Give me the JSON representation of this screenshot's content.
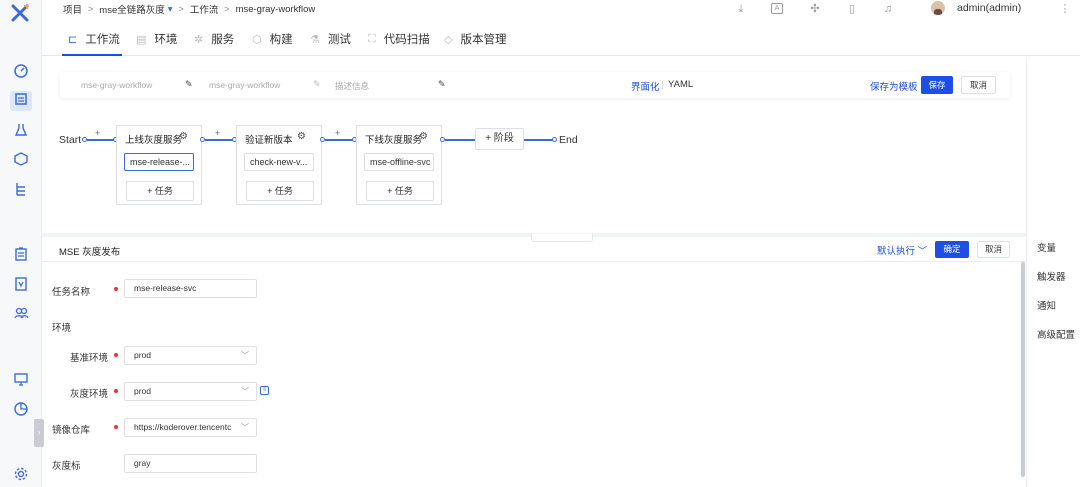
{
  "breadcrumb": {
    "items": [
      "项目",
      "mse全链路灰度",
      "工作流",
      "mse-gray-workflow"
    ],
    "project_dropdown": "▾",
    "sep": ">"
  },
  "header": {
    "user": "admin(admin)",
    "icons": [
      "download-icon",
      "translate-icon",
      "network-icon",
      "docs-icon",
      "bell-icon",
      "more-icon"
    ]
  },
  "tabs": [
    {
      "label": "工作流",
      "icon": "workflow-icon"
    },
    {
      "label": "环境",
      "icon": "environment-icon"
    },
    {
      "label": "服务",
      "icon": "service-icon"
    },
    {
      "label": "构建",
      "icon": "build-icon"
    },
    {
      "label": "测试",
      "icon": "test-icon"
    },
    {
      "label": "代码扫描",
      "icon": "scan-icon"
    },
    {
      "label": "版本管理",
      "icon": "version-icon"
    }
  ],
  "toolbar": {
    "name_placeholder": "mse-gray-workflow",
    "display_placeholder": "mse-gray-workflow",
    "desc_placeholder": "描述信息",
    "mode_ui": "界面化",
    "mode_sep": "|",
    "mode_yaml": "YAML",
    "save_template": "保存为模板",
    "save": "保存",
    "cancel": "取消"
  },
  "pipeline": {
    "start": "Start",
    "end": "End",
    "plus": "+",
    "add_stage": "+ 阶段",
    "add_task": "+ 任务",
    "stages": [
      {
        "name": "上线灰度服务",
        "job": "mse-release-..."
      },
      {
        "name": "验证新版本",
        "job": "check-new-v..."
      },
      {
        "name": "下线灰度服务",
        "job": "mse-offline-svc"
      }
    ]
  },
  "job_panel": {
    "title": "MSE 灰度发布",
    "exec_mode": "默认执行",
    "confirm": "确定",
    "cancel": "取消",
    "fields": {
      "task_name_label": "任务名称",
      "task_name": "mse-release-svc",
      "env_label": "环境",
      "base_env_label": "基准环境",
      "base_env": "prod",
      "gray_env_label": "灰度环境",
      "gray_env": "prod",
      "image_repo_label": "镜像仓库",
      "image_repo": "https://koderover.tencentc",
      "gray_tag_label": "灰度标",
      "gray_tag": "gray"
    }
  },
  "right_panel": [
    "变量",
    "触发器",
    "通知",
    "高级配置"
  ],
  "colors": {
    "primary": "#1e4ee6",
    "accent": "#3b6bd6",
    "required": "#e53935"
  }
}
